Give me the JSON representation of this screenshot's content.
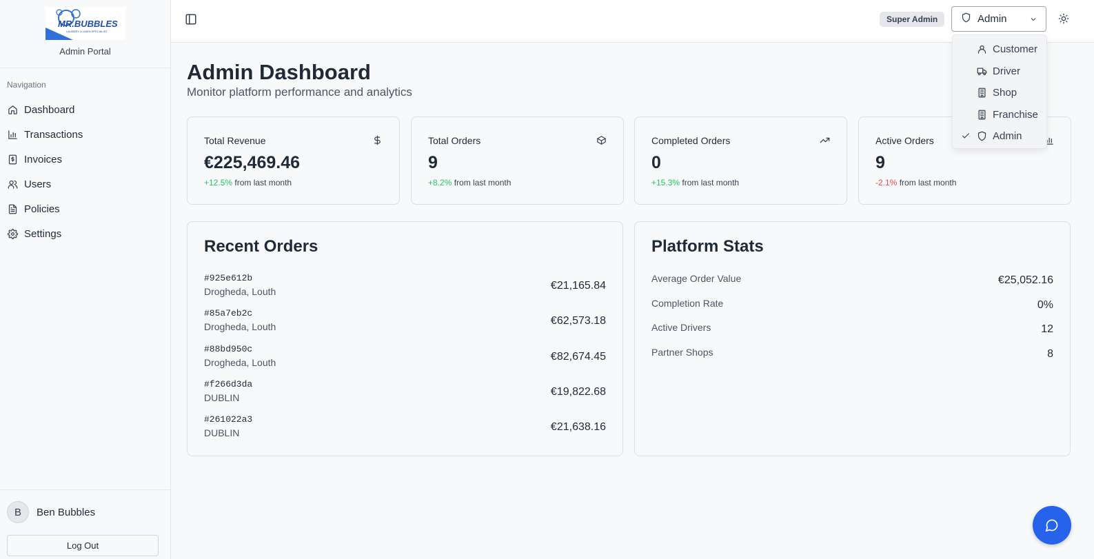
{
  "sidebar": {
    "logo_text": "MR. BUBBLES",
    "logo_tagline": "LAUNDRY & LINEN SPECIALIST",
    "portal_label": "Admin Portal",
    "nav_title": "Navigation",
    "items": [
      {
        "label": "Dashboard",
        "icon": "home-icon"
      },
      {
        "label": "Transactions",
        "icon": "bar-chart-icon"
      },
      {
        "label": "Invoices",
        "icon": "receipt-icon"
      },
      {
        "label": "Users",
        "icon": "users-icon"
      },
      {
        "label": "Policies",
        "icon": "file-text-icon"
      },
      {
        "label": "Settings",
        "icon": "gear-icon"
      }
    ],
    "user": {
      "initial": "B",
      "name": "Ben Bubbles"
    },
    "logout_label": "Log Out"
  },
  "header": {
    "role_badge": "Super Admin",
    "role_select": {
      "value": "Admin",
      "icon": "shield-icon"
    }
  },
  "dropdown": {
    "options": [
      {
        "label": "Customer",
        "icon": "user-icon",
        "selected": false
      },
      {
        "label": "Driver",
        "icon": "truck-icon",
        "selected": false
      },
      {
        "label": "Shop",
        "icon": "building-icon",
        "selected": false
      },
      {
        "label": "Franchise",
        "icon": "building-icon",
        "selected": false
      },
      {
        "label": "Admin",
        "icon": "shield-icon",
        "selected": true
      }
    ]
  },
  "page": {
    "title": "Admin Dashboard",
    "subtitle": "Monitor platform performance and analytics"
  },
  "stats": [
    {
      "title": "Total Revenue",
      "value": "€225,469.46",
      "change": "+12.5%",
      "change_suffix": "from last month",
      "trend": "positive",
      "icon": "dollar-icon"
    },
    {
      "title": "Total Orders",
      "value": "9",
      "change": "+8.2%",
      "change_suffix": "from last month",
      "trend": "positive",
      "icon": "package-icon"
    },
    {
      "title": "Completed Orders",
      "value": "0",
      "change": "+15.3%",
      "change_suffix": "from last month",
      "trend": "positive",
      "icon": "trending-up-icon"
    },
    {
      "title": "Active Orders",
      "value": "9",
      "change": "-2.1%",
      "change_suffix": "from last month",
      "trend": "negative",
      "icon": "bar-chart-icon"
    }
  ],
  "recent_orders": {
    "title": "Recent Orders",
    "orders": [
      {
        "id": "#925e612b",
        "location": "Drogheda, Louth",
        "amount": "€21,165.84"
      },
      {
        "id": "#85a7eb2c",
        "location": "Drogheda, Louth",
        "amount": "€62,573.18"
      },
      {
        "id": "#88bd950c",
        "location": "Drogheda, Louth",
        "amount": "€82,674.45"
      },
      {
        "id": "#f266d3da",
        "location": "DUBLIN",
        "amount": "€19,822.68"
      },
      {
        "id": "#261022a3",
        "location": "DUBLIN",
        "amount": "€21,638.16"
      }
    ]
  },
  "platform_stats": {
    "title": "Platform Stats",
    "rows": [
      {
        "label": "Average Order Value",
        "value": "€25,052.16"
      },
      {
        "label": "Completion Rate",
        "value": "0%"
      },
      {
        "label": "Active Drivers",
        "value": "12"
      },
      {
        "label": "Partner Shops",
        "value": "8"
      }
    ]
  },
  "colors": {
    "accent": "#2563eb",
    "positive": "#22c55e",
    "negative": "#ef4444"
  }
}
